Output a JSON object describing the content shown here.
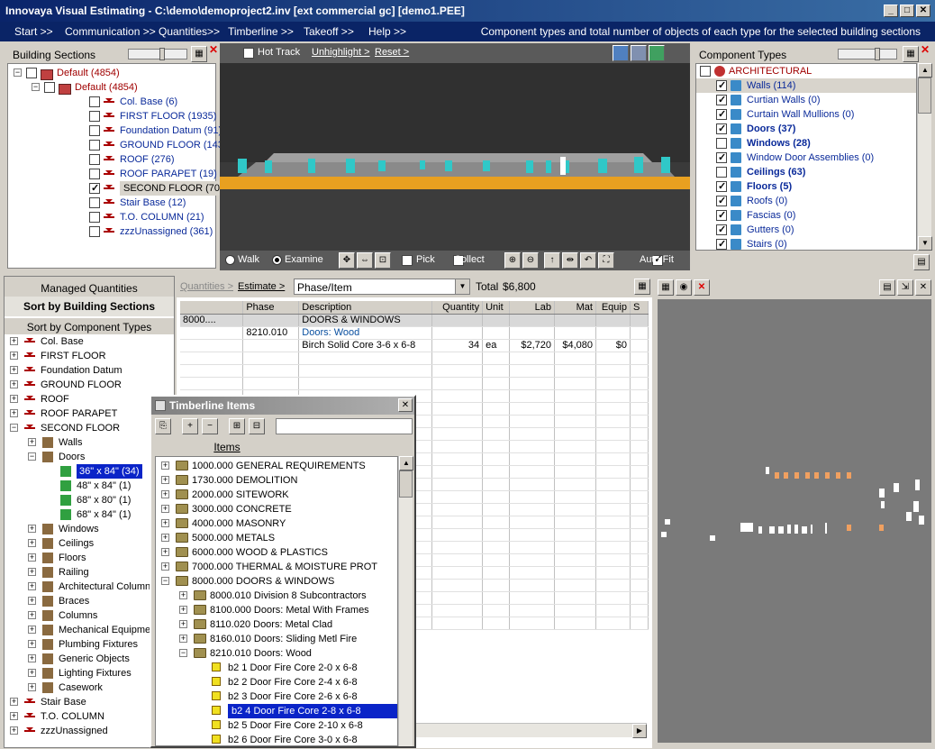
{
  "window": {
    "title": "Innovaya Visual Estimating - C:\\demo\\demoproject2.inv [ext commercial gc] [demo1.PEE]"
  },
  "menu": {
    "items": [
      "Start >>",
      "Communication >>",
      "Quantities>>",
      "Timberline >>",
      "Takeoff >>",
      "Help >>"
    ],
    "status": "Component types and total number of objects of each type for the selected building sections"
  },
  "building_sections": {
    "title": "Building Sections",
    "items": [
      {
        "label": "Default (4854)",
        "level": 0,
        "checked": false,
        "sel": false
      },
      {
        "label": "Default (4854)",
        "level": 1,
        "checked": false,
        "sel": false
      },
      {
        "label": "Col. Base (6)",
        "level": 2,
        "checked": false,
        "sel": false
      },
      {
        "label": "FIRST FLOOR (1935)",
        "level": 2,
        "checked": false,
        "sel": false
      },
      {
        "label": "Foundation Datum (91)",
        "level": 2,
        "checked": false,
        "sel": false
      },
      {
        "label": "GROUND FLOOR (1432)",
        "level": 2,
        "checked": false,
        "sel": false
      },
      {
        "label": "ROOF (276)",
        "level": 2,
        "checked": false,
        "sel": false
      },
      {
        "label": "ROOF PARAPET (19)",
        "level": 2,
        "checked": false,
        "sel": false
      },
      {
        "label": "SECOND FLOOR (701)",
        "level": 2,
        "checked": true,
        "sel": true
      },
      {
        "label": "Stair Base (12)",
        "level": 2,
        "checked": false,
        "sel": false
      },
      {
        "label": "T.O. COLUMN (21)",
        "level": 2,
        "checked": false,
        "sel": false
      },
      {
        "label": "zzzUnassigned (361)",
        "level": 2,
        "checked": false,
        "sel": false
      }
    ]
  },
  "viewer": {
    "hot_track": "Hot Track",
    "unhighlight": "Unhighlight >",
    "reset": "Reset >",
    "walk": "Walk",
    "examine": "Examine",
    "pick": "Pick",
    "collect": "Collect",
    "auto_fit": "Auto Fit"
  },
  "component_types": {
    "title": "Component Types",
    "items": [
      {
        "label": "ARCHITECTURAL",
        "checked": false,
        "bold": false,
        "color": "#a00000",
        "sel": false
      },
      {
        "label": "Walls (114)",
        "checked": true,
        "bold": false,
        "color": "#0a2a9a",
        "sel": true
      },
      {
        "label": "Curtian Walls (0)",
        "checked": true,
        "bold": false,
        "color": "#0a2a9a",
        "sel": false
      },
      {
        "label": "Curtain Wall Mullions (0)",
        "checked": true,
        "bold": false,
        "color": "#0a2a9a",
        "sel": false
      },
      {
        "label": "Doors (37)",
        "checked": true,
        "bold": true,
        "color": "#0a2a9a",
        "sel": false
      },
      {
        "label": "Windows (28)",
        "checked": false,
        "bold": true,
        "color": "#0a2a9a",
        "sel": false
      },
      {
        "label": "Window Door Assemblies (0)",
        "checked": true,
        "bold": false,
        "color": "#0a2a9a",
        "sel": false
      },
      {
        "label": "Ceilings (63)",
        "checked": false,
        "bold": true,
        "color": "#0a2a9a",
        "sel": false
      },
      {
        "label": "Floors (5)",
        "checked": true,
        "bold": true,
        "color": "#0a2a9a",
        "sel": false
      },
      {
        "label": "Roofs (0)",
        "checked": true,
        "bold": false,
        "color": "#0a2a9a",
        "sel": false
      },
      {
        "label": "Fascias (0)",
        "checked": true,
        "bold": false,
        "color": "#0a2a9a",
        "sel": false
      },
      {
        "label": "Gutters (0)",
        "checked": true,
        "bold": false,
        "color": "#0a2a9a",
        "sel": false
      },
      {
        "label": "Stairs (0)",
        "checked": true,
        "bold": false,
        "color": "#0a2a9a",
        "sel": false
      }
    ]
  },
  "managed": {
    "title": "Managed Quantities",
    "sort1": "Sort by Building Sections",
    "sort2": "Sort by Component Types",
    "items": [
      {
        "label": "Col. Base",
        "level": 0,
        "exp": "+"
      },
      {
        "label": "FIRST FLOOR",
        "level": 0,
        "exp": "+"
      },
      {
        "label": "Foundation Datum",
        "level": 0,
        "exp": "+"
      },
      {
        "label": "GROUND FLOOR",
        "level": 0,
        "exp": "+"
      },
      {
        "label": "ROOF",
        "level": 0,
        "exp": "+"
      },
      {
        "label": "ROOF PARAPET",
        "level": 0,
        "exp": "+"
      },
      {
        "label": "SECOND FLOOR",
        "level": 0,
        "exp": "-"
      },
      {
        "label": "Walls",
        "level": 1,
        "exp": "+"
      },
      {
        "label": "Doors",
        "level": 1,
        "exp": "-"
      },
      {
        "label": "36\" x 84\" (34)",
        "level": 2,
        "exp": "",
        "sel": true
      },
      {
        "label": "48\" x 84\" (1)",
        "level": 2,
        "exp": ""
      },
      {
        "label": "68\" x 80\" (1)",
        "level": 2,
        "exp": ""
      },
      {
        "label": "68\" x 84\" (1)",
        "level": 2,
        "exp": ""
      },
      {
        "label": "Windows",
        "level": 1,
        "exp": "+"
      },
      {
        "label": "Ceilings",
        "level": 1,
        "exp": "+"
      },
      {
        "label": "Floors",
        "level": 1,
        "exp": "+"
      },
      {
        "label": "Railing",
        "level": 1,
        "exp": "+"
      },
      {
        "label": "Architectural Column",
        "level": 1,
        "exp": "+"
      },
      {
        "label": "Braces",
        "level": 1,
        "exp": "+"
      },
      {
        "label": "Columns",
        "level": 1,
        "exp": "+"
      },
      {
        "label": "Mechanical Equipmer",
        "level": 1,
        "exp": "+"
      },
      {
        "label": "Plumbing Fixtures",
        "level": 1,
        "exp": "+"
      },
      {
        "label": "Generic Objects",
        "level": 1,
        "exp": "+"
      },
      {
        "label": "Lighting Fixtures",
        "level": 1,
        "exp": "+"
      },
      {
        "label": "Casework",
        "level": 1,
        "exp": "+"
      },
      {
        "label": "Stair Base",
        "level": 0,
        "exp": "+"
      },
      {
        "label": "T.O. COLUMN",
        "level": 0,
        "exp": "+"
      },
      {
        "label": "zzzUnassigned",
        "level": 0,
        "exp": "+"
      }
    ]
  },
  "estimate": {
    "quantities": "Quantities >",
    "estimate": "Estimate >",
    "dropdown": "Phase/Item",
    "total_label": "Total",
    "total": "$6,800",
    "columns": [
      "",
      "Phase",
      "Description",
      "Quantity",
      "Unit",
      "Lab",
      "Mat",
      "Equip",
      "S"
    ],
    "rows": [
      [
        "8000....",
        "",
        "DOORS & WINDOWS",
        "",
        "",
        "",
        "",
        "",
        ""
      ],
      [
        "",
        "8210.010",
        "Doors: Wood",
        "",
        "",
        "",
        "",
        "",
        ""
      ],
      [
        "",
        "",
        "Birch Solid Core 3-6  x 6-8",
        "34",
        "ea",
        "$2,720",
        "$4,080",
        "$0",
        ""
      ]
    ]
  },
  "timberline": {
    "title": "Timberline Items",
    "items_header": "Items",
    "items": [
      {
        "label": "1000.000 GENERAL REQUIREMENTS",
        "level": 0,
        "exp": "+"
      },
      {
        "label": "1730.000 DEMOLITION",
        "level": 0,
        "exp": "+"
      },
      {
        "label": "2000.000 SITEWORK",
        "level": 0,
        "exp": "+"
      },
      {
        "label": "3000.000 CONCRETE",
        "level": 0,
        "exp": "+"
      },
      {
        "label": "4000.000 MASONRY",
        "level": 0,
        "exp": "+"
      },
      {
        "label": "5000.000 METALS",
        "level": 0,
        "exp": "+"
      },
      {
        "label": "6000.000 WOOD & PLASTICS",
        "level": 0,
        "exp": "+"
      },
      {
        "label": "7000.000 THERMAL & MOISTURE PROT",
        "level": 0,
        "exp": "+"
      },
      {
        "label": "8000.000 DOORS & WINDOWS",
        "level": 0,
        "exp": "-"
      },
      {
        "label": "8000.010 Division 8 Subcontractors",
        "level": 1,
        "exp": "+"
      },
      {
        "label": "8100.000 Doors: Metal With Frames",
        "level": 1,
        "exp": "+"
      },
      {
        "label": "8110.020 Doors: Metal Clad",
        "level": 1,
        "exp": "+"
      },
      {
        "label": "8160.010 Doors: Sliding Metl Fire",
        "level": 1,
        "exp": "+"
      },
      {
        "label": "8210.010 Doors: Wood",
        "level": 1,
        "exp": "-"
      },
      {
        "label": "b2 1 Door Fire Core 2-0  x 6-8",
        "level": 2,
        "exp": ""
      },
      {
        "label": "b2 2 Door Fire Core 2-4  x 6-8",
        "level": 2,
        "exp": ""
      },
      {
        "label": "b2 3 Door Fire Core 2-6  x 6-8",
        "level": 2,
        "exp": ""
      },
      {
        "label": "b2 4 Door Fire Core 2-8  x 6-8",
        "level": 2,
        "exp": "",
        "sel": true
      },
      {
        "label": "b2 5 Door Fire Core 2-10 x 6-8",
        "level": 2,
        "exp": ""
      },
      {
        "label": "b2 6 Door Fire Core 3-0  x 6-8",
        "level": 2,
        "exp": ""
      }
    ]
  }
}
